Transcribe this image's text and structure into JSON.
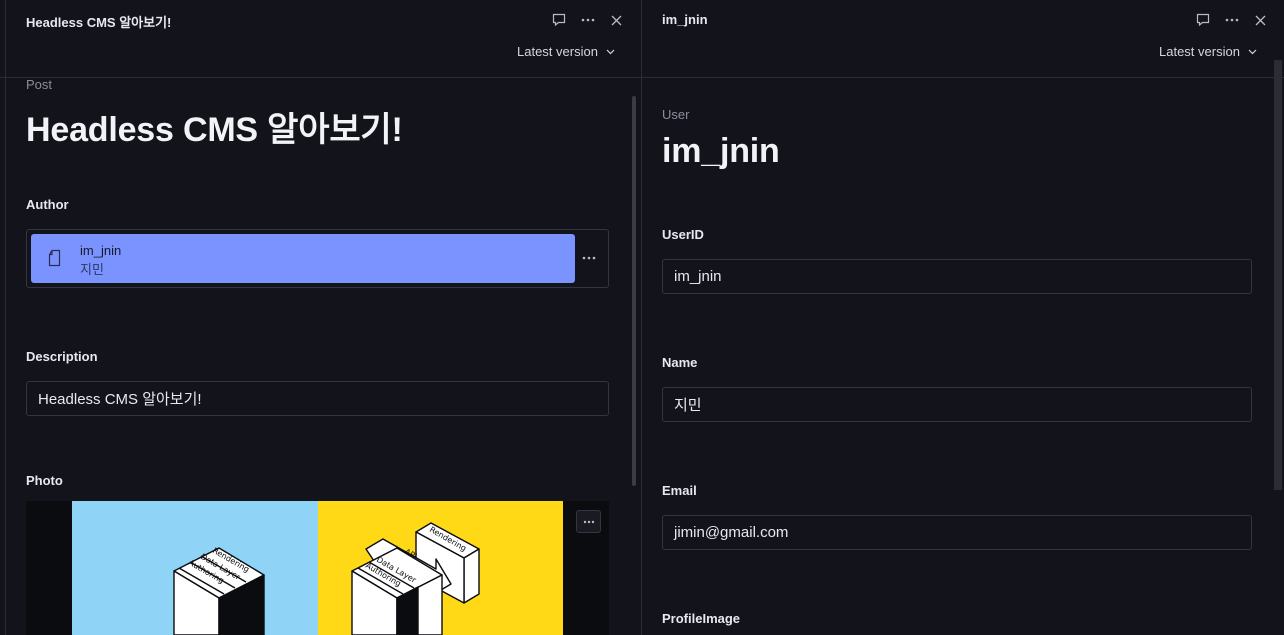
{
  "left": {
    "header_title": "Headless CMS 알아보기!",
    "version_label": "Latest version",
    "type_label": "Post",
    "doc_title": "Headless CMS 알아보기!",
    "author": {
      "label": "Author",
      "ref_name": "im_jnin",
      "ref_sub": "지민"
    },
    "description": {
      "label": "Description",
      "value": "Headless CMS 알아보기!"
    },
    "photo": {
      "label": "Photo",
      "left_box_lines": [
        "Rendering",
        "Data Layer",
        "Authoring"
      ],
      "right_box_lines": [
        "API",
        "Data Layer",
        "Authoring"
      ],
      "right_panel_line": "Rendering"
    }
  },
  "right": {
    "header_title": "im_jnin",
    "version_label": "Latest version",
    "type_label": "User",
    "doc_title": "im_jnin",
    "fields": [
      {
        "label": "UserID",
        "value": "im_jnin"
      },
      {
        "label": "Name",
        "value": "지민"
      },
      {
        "label": "Email",
        "value": "jimin@gmail.com"
      }
    ],
    "next_field_label": "ProfileImage"
  },
  "colors": {
    "background": "#13141b",
    "reference_card": "#7b93ff",
    "photo_left_bg": "#8fd3f7",
    "photo_right_bg": "#ffd915"
  },
  "icons": {
    "comment": "comment-icon",
    "more": "more-icon",
    "close": "close-icon",
    "chevron": "chevron-down-icon",
    "document": "document-icon"
  }
}
